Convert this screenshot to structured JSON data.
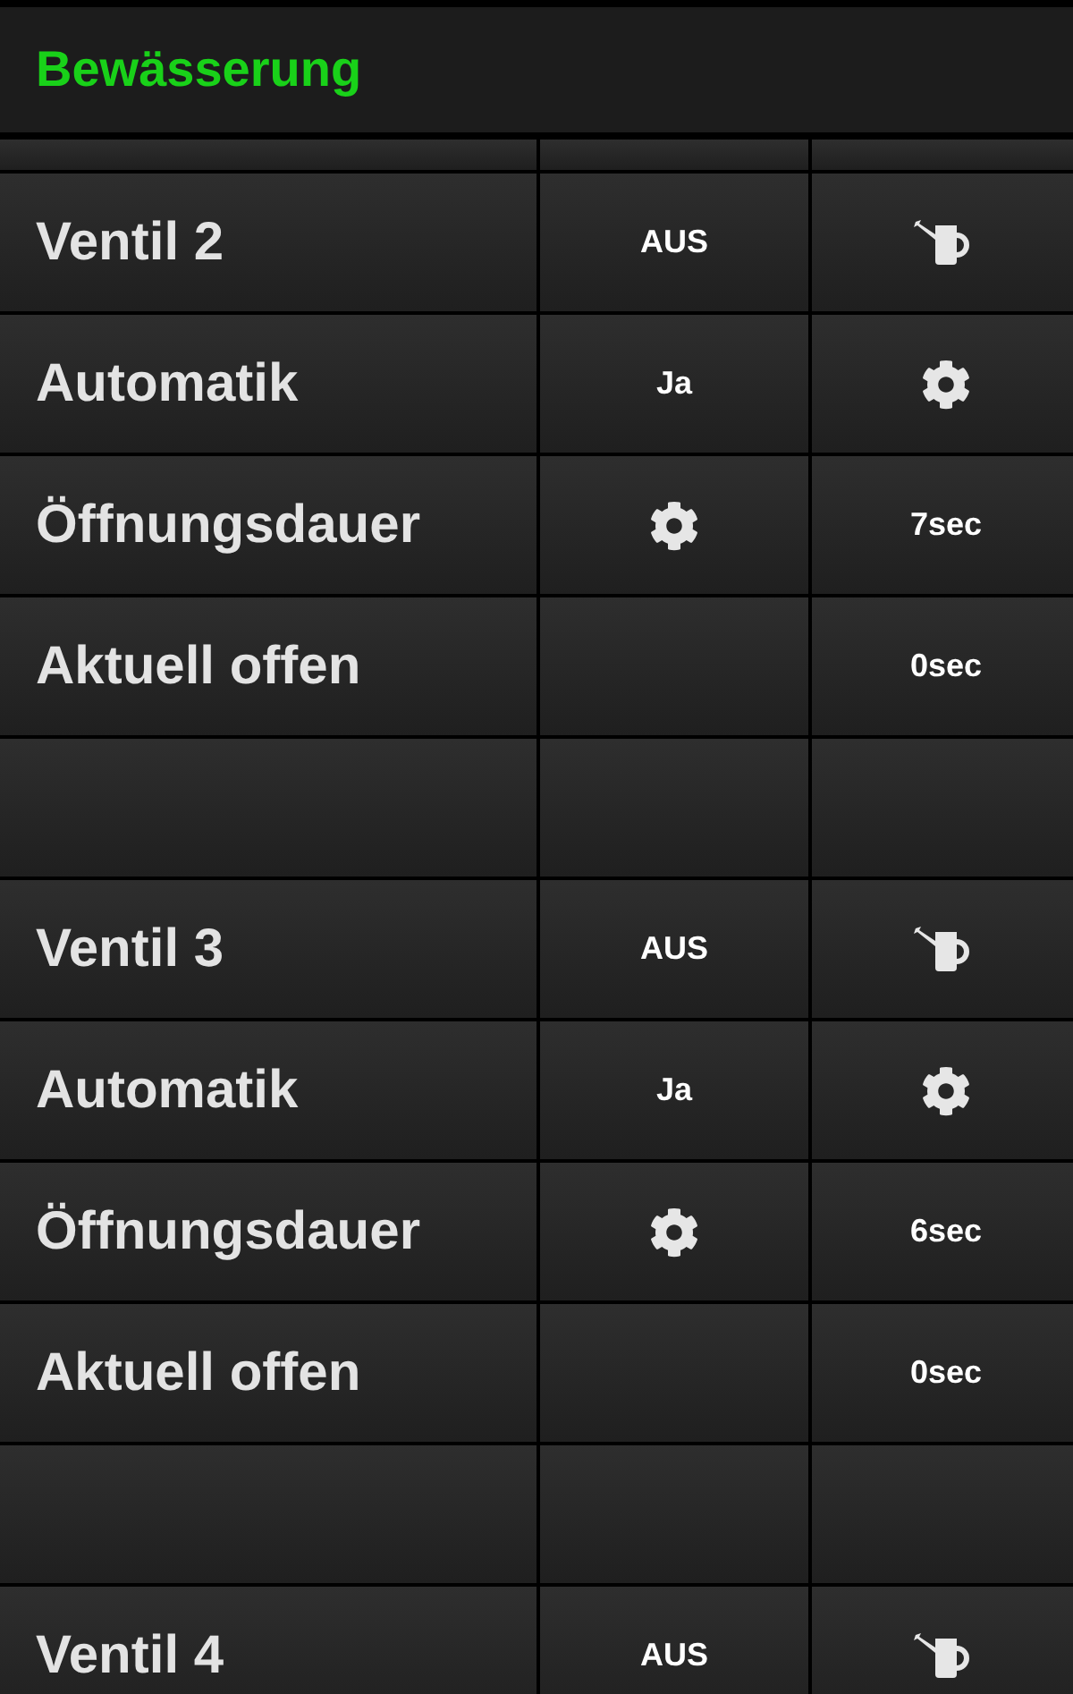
{
  "header": {
    "title": "Bewässerung"
  },
  "rows": [
    {
      "kind": "partial"
    },
    {
      "kind": "item",
      "label": "Ventil 2",
      "cells": [
        {
          "kind": "text",
          "text": "AUS"
        },
        {
          "kind": "can"
        }
      ]
    },
    {
      "kind": "item",
      "label": "Automatik",
      "cells": [
        {
          "kind": "text",
          "text": "Ja"
        },
        {
          "kind": "gear"
        }
      ]
    },
    {
      "kind": "item",
      "label": "Öffnungsdauer",
      "cells": [
        {
          "kind": "gear"
        },
        {
          "kind": "text",
          "text": "7sec"
        }
      ]
    },
    {
      "kind": "item",
      "label": "Aktuell offen",
      "cells": [
        {
          "kind": "empty"
        },
        {
          "kind": "text",
          "text": "0sec"
        }
      ]
    },
    {
      "kind": "spacer"
    },
    {
      "kind": "item",
      "label": "Ventil 3",
      "cells": [
        {
          "kind": "text",
          "text": "AUS"
        },
        {
          "kind": "can"
        }
      ]
    },
    {
      "kind": "item",
      "label": "Automatik",
      "cells": [
        {
          "kind": "text",
          "text": "Ja"
        },
        {
          "kind": "gear"
        }
      ]
    },
    {
      "kind": "item",
      "label": "Öffnungsdauer",
      "cells": [
        {
          "kind": "gear"
        },
        {
          "kind": "text",
          "text": "6sec"
        }
      ]
    },
    {
      "kind": "item",
      "label": "Aktuell offen",
      "cells": [
        {
          "kind": "empty"
        },
        {
          "kind": "text",
          "text": "0sec"
        }
      ]
    },
    {
      "kind": "spacer"
    },
    {
      "kind": "item",
      "label": "Ventil 4",
      "cells": [
        {
          "kind": "text",
          "text": "AUS"
        },
        {
          "kind": "can"
        }
      ]
    }
  ]
}
